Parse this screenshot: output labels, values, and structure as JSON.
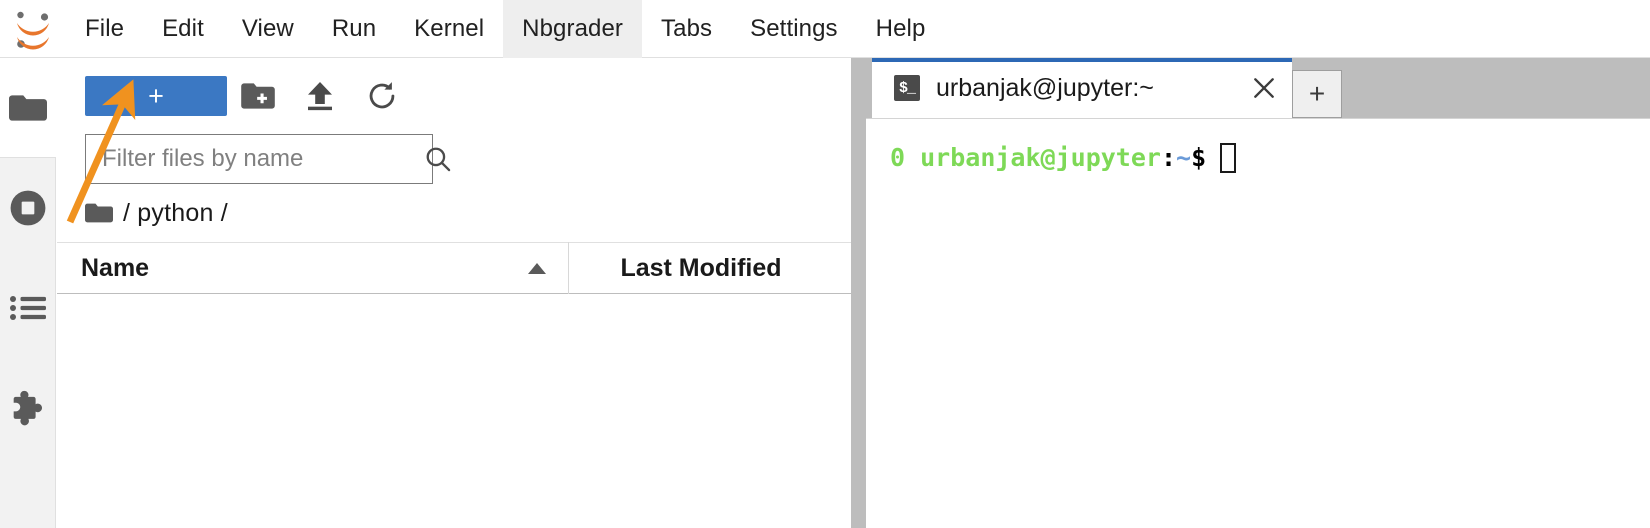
{
  "app": {
    "name": "JupyterLab",
    "logo_icon": "jupyter-logo-icon",
    "accent_blue": "#3b78c3",
    "tab_accent": "#2c68b5",
    "annotation_color": "#f0921f"
  },
  "menubar": {
    "items": [
      {
        "label": "File",
        "active": false
      },
      {
        "label": "Edit",
        "active": false
      },
      {
        "label": "View",
        "active": false
      },
      {
        "label": "Run",
        "active": false
      },
      {
        "label": "Kernel",
        "active": false
      },
      {
        "label": "Nbgrader",
        "active": true
      },
      {
        "label": "Tabs",
        "active": false
      },
      {
        "label": "Settings",
        "active": false
      },
      {
        "label": "Help",
        "active": false
      }
    ]
  },
  "activitybar": {
    "items": [
      {
        "icon": "folder-icon",
        "title": "File Browser",
        "selected": true
      },
      {
        "icon": "running-icon",
        "title": "Running Terminals and Kernels",
        "selected": false
      },
      {
        "icon": "commands-icon",
        "title": "Commands",
        "selected": false
      },
      {
        "icon": "extension-icon",
        "title": "Extension Manager",
        "selected": false
      }
    ]
  },
  "filebrowser": {
    "toolbar": {
      "new_launcher_label": "+",
      "new_launcher_icon": "plus-icon",
      "new_folder_icon": "new-folder-icon",
      "upload_icon": "upload-icon",
      "refresh_icon": "refresh-icon"
    },
    "filter": {
      "placeholder": "Filter files by name",
      "value": "",
      "icon": "search-icon"
    },
    "breadcrumb": {
      "home_icon": "folder-icon",
      "path": "/ python /"
    },
    "columns": [
      {
        "label": "Name",
        "sort": "ascending",
        "sort_icon": "caret-up-icon"
      },
      {
        "label": "Last Modified",
        "sort": "none"
      }
    ],
    "rows": []
  },
  "dock": {
    "tabs": [
      {
        "label": "urbanjak@jupyter:~",
        "icon": "terminal-icon",
        "icon_text": "$_",
        "active": true,
        "close_icon": "close-icon"
      }
    ],
    "new_tab_button": {
      "label": "+",
      "icon": "plus-icon"
    }
  },
  "terminal": {
    "prompt": {
      "exit_code": "0",
      "user_host": "urbanjak@jupyter",
      "colon": ":",
      "path": "~",
      "sigil": "$",
      "full_text": "0 urbanjak@jupyter:~$"
    },
    "input_value": "",
    "cursor": "hollow-block"
  },
  "annotation": {
    "type": "arrow",
    "points_to": "new-launcher-button",
    "color": "#f0921f"
  }
}
